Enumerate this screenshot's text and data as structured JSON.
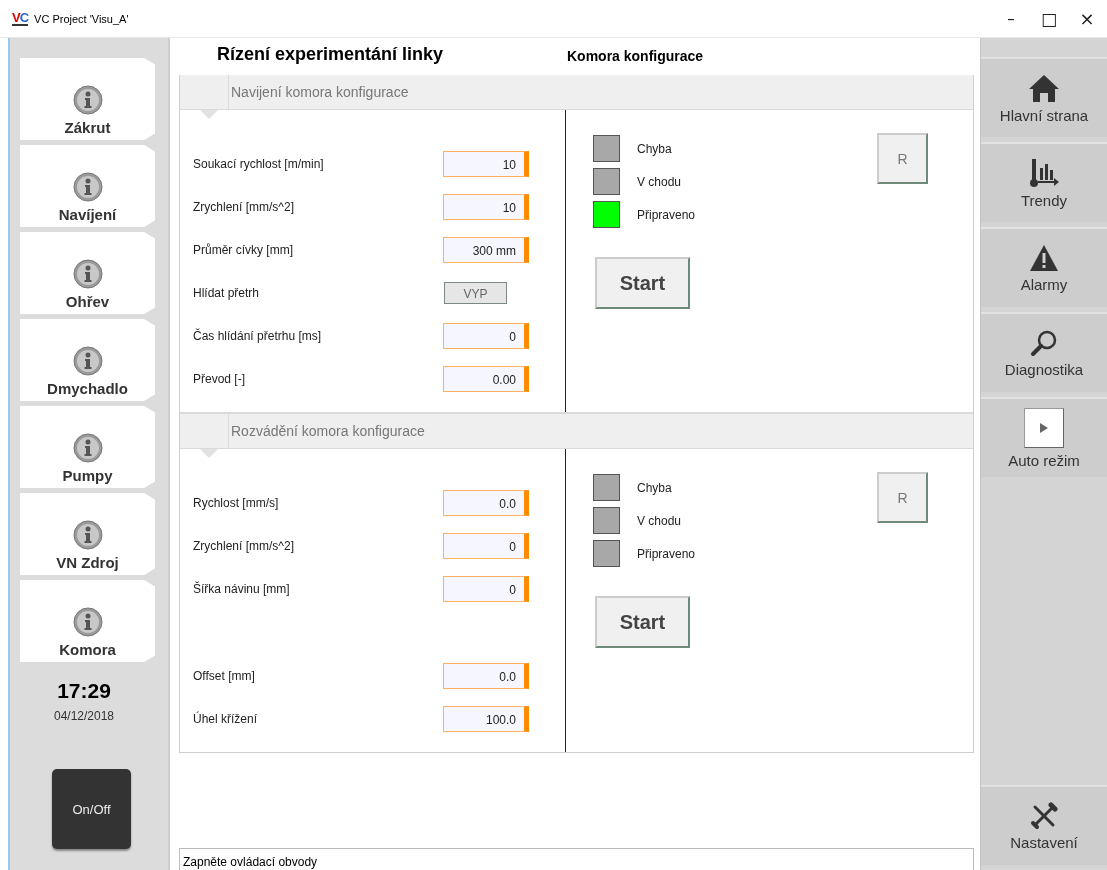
{
  "window": {
    "logo": "VC",
    "title": "VC Project 'Visu_A'",
    "controls": [
      {
        "kind": "minimize",
        "label": "–"
      },
      {
        "kind": "maximize",
        "label": "□"
      },
      {
        "kind": "close",
        "label": "×"
      }
    ]
  },
  "left_nav": {
    "items": [
      {
        "label": "Zákrut"
      },
      {
        "label": "Navíjení"
      },
      {
        "label": "Ohřev"
      },
      {
        "label": "Dmychadlo"
      },
      {
        "label": "Pumpy"
      },
      {
        "label": "VN Zdroj"
      },
      {
        "label": "Komora"
      }
    ],
    "time": "17:29",
    "date": "04/12/2018",
    "power_button": "On/Off"
  },
  "header": {
    "title": "Rízení experimentání linky",
    "subtitle": "Komora konfigurace"
  },
  "sections": [
    {
      "title": "Navijení komora konfigurace",
      "fields": [
        {
          "label": "Soukací rychlost [m/min]",
          "kind": "input",
          "value": "10"
        },
        {
          "label": "Zrychlení [mm/s^2]",
          "kind": "input",
          "value": "10"
        },
        {
          "label": "Průměr cívky [mm]",
          "kind": "input",
          "value": "300  mm"
        },
        {
          "label": "Hlídat přetrh",
          "kind": "toggle",
          "value": "VYP"
        },
        {
          "label": "Čas hlídání přetrhu [ms]",
          "kind": "input",
          "value": "0"
        },
        {
          "label": "Převod [-]",
          "kind": "input",
          "value": "0.00"
        }
      ],
      "indicators": [
        {
          "label": "Chyba",
          "on": false
        },
        {
          "label": "V chodu",
          "on": false
        },
        {
          "label": "Připraveno",
          "on": true
        }
      ],
      "reset_button": "R",
      "start_button": "Start"
    },
    {
      "title": "Rozvádění komora konfigurace",
      "fields": [
        {
          "label": "Rychlost [mm/s]",
          "kind": "input",
          "value": "0.0"
        },
        {
          "label": "Zrychlení  [mm/s^2]",
          "kind": "input",
          "value": "0"
        },
        {
          "label": "Šířka návinu [mm]",
          "kind": "input",
          "value": "0"
        }
      ],
      "lower_fields": [
        {
          "label": "Offset [mm]",
          "kind": "input",
          "value": "0.0"
        },
        {
          "label": "Úhel křížení",
          "kind": "input",
          "value": "100.0"
        }
      ],
      "indicators": [
        {
          "label": "Chyba",
          "on": false
        },
        {
          "label": "V chodu",
          "on": false
        },
        {
          "label": "Připraveno",
          "on": false
        }
      ],
      "reset_button": "R",
      "start_button": "Start"
    }
  ],
  "status_bar": {
    "message": "Zapněte ovládací obvody"
  },
  "right_nav": {
    "items": [
      {
        "kind": "home",
        "label": "Hlavní strana"
      },
      {
        "kind": "trends",
        "label": "Trendy"
      },
      {
        "kind": "alarm",
        "label": "Alarmy"
      },
      {
        "kind": "search",
        "label": "Diagnostika"
      },
      {
        "kind": "play",
        "label": "Auto režim"
      }
    ],
    "bottom_items": [
      {
        "kind": "tools",
        "label": "Nastavení"
      }
    ]
  }
}
